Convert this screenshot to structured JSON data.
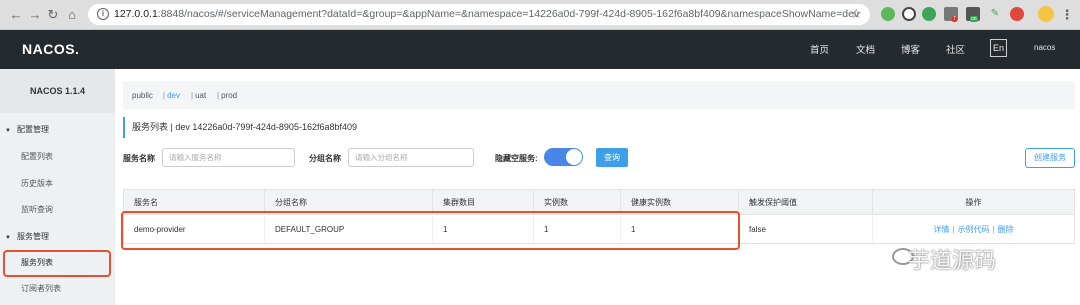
{
  "browser": {
    "url_host": "127.0.0.1",
    "url_rest": ":8848/nacos/#/serviceManagement?dataId=&group=&appName=&namespace=14226a0d-799f-424d-8905-162f6a8bf409&namespaceShowName=dev",
    "badge_count": "7",
    "badge_on": "on"
  },
  "header": {
    "logo": "NACOS.",
    "nav": [
      "首页",
      "文档",
      "博客",
      "社区"
    ],
    "lang": "En",
    "user": "nacos"
  },
  "sidebar": {
    "title": "NACOS 1.1.4",
    "groups": [
      {
        "label": "配置管理",
        "items": [
          "配置列表",
          "历史版本",
          "监听查询"
        ]
      },
      {
        "label": "服务管理",
        "items": [
          "服务列表",
          "订阅者列表"
        ]
      }
    ]
  },
  "namespaces": [
    "public",
    "dev",
    "uat",
    "prod"
  ],
  "section_title": "服务列表  |  dev  14226a0d-799f-424d-8905-162f6a8bf409",
  "filters": {
    "service_label": "服务名称",
    "service_placeholder": "请输入服务名称",
    "group_label": "分组名称",
    "group_placeholder": "请输入分组名称",
    "hide_empty_label": "隐藏空服务:",
    "query_button": "查询",
    "create_button": "创建服务"
  },
  "table": {
    "columns": [
      "服务名",
      "分组名称",
      "集群数目",
      "实例数",
      "健康实例数",
      "触发保护阈值",
      "操作"
    ],
    "rows": [
      {
        "name": "demo-provider",
        "group": "DEFAULT_GROUP",
        "clusters": "1",
        "instances": "1",
        "healthy": "1",
        "protect": "false",
        "ops": [
          "详情",
          "示例代码",
          "删除"
        ]
      }
    ]
  },
  "watermark": "芋道源码",
  "colors": {
    "accent": "#3d9fe8",
    "highlight": "#e6502f",
    "topbar": "#252a2f"
  }
}
